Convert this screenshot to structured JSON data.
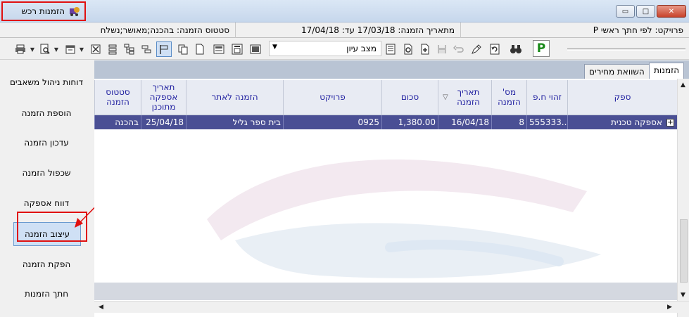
{
  "window": {
    "title": "הזמנות רכש",
    "controls": {
      "minimize": "▭",
      "maximize": "□",
      "close": "✕"
    },
    "accent": "#e01010"
  },
  "info": {
    "project": "פרויקט: לפי חתך ראשי P",
    "date_range": "מתאריך הזמנה:  17/03/18  עד: 17/04/18",
    "status": "סטטוס הזמנה: בהכנה;מאושר;נשלח"
  },
  "toolbar": {
    "view_mode": "מצב עיון",
    "p_button": "P"
  },
  "sidebar": {
    "items": [
      {
        "label": "דוחות ניהול משאבים"
      },
      {
        "label": "הוספת הזמנה"
      },
      {
        "label": "עדכון הזמנה"
      },
      {
        "label": "שכפול הזמנה"
      },
      {
        "label": "דווח אספקה"
      },
      {
        "label": "עיצוב הזמנה"
      },
      {
        "label": "הפקת הזמנה"
      },
      {
        "label": "חתך הזמנות"
      }
    ]
  },
  "tabs": [
    {
      "label": "הזמנות"
    },
    {
      "label": "השוואת מחירים"
    }
  ],
  "grid": {
    "headers": {
      "supplier": "ספק",
      "company_id": "זהוי ח.פ",
      "order_no": "מס' הזמנה",
      "order_date": "תאריך הזמנה",
      "amount": "סכום",
      "project": "פרויקט",
      "order_after": "הזמנה לאתר",
      "planned_supply": "תאריך אספקה מתוכנן",
      "order_status": "סטטוס הזמנה"
    },
    "rows": [
      {
        "supplier": "אספקה טכנית",
        "company_id": "555333...",
        "order_no": "8",
        "order_date": "16/04/18",
        "amount": "1,380.00",
        "project": "0925",
        "order_after": "בית ספר גליל",
        "planned_supply": "25/04/18",
        "order_status": "בהכנה"
      }
    ]
  }
}
